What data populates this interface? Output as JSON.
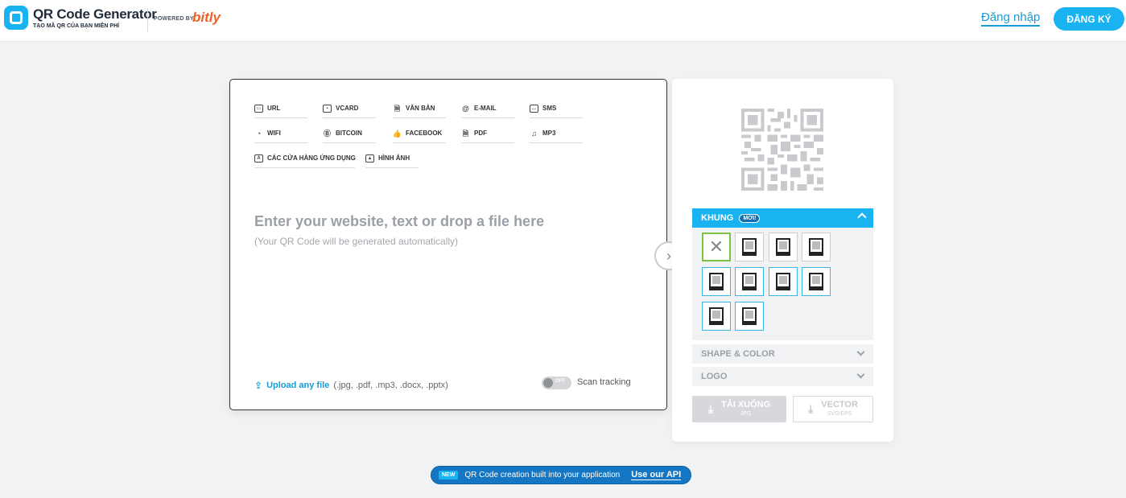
{
  "header": {
    "brand_title": "QR Code Generator",
    "brand_subtitle": "TẠO MÃ QR CỦA BẠN MIỄN PHÍ",
    "powered_by": "POWERED BY",
    "partner": "bitly",
    "login_label": "Đăng nhập",
    "signup_label": "ĐĂNG KÝ"
  },
  "types": [
    {
      "label": "URL",
      "icon": "url-icon"
    },
    {
      "label": "VCARD",
      "icon": "vcard-icon"
    },
    {
      "label": "VĂN BẢN",
      "icon": "text-icon"
    },
    {
      "label": "E-MAIL",
      "icon": "email-icon"
    },
    {
      "label": "SMS",
      "icon": "sms-icon"
    },
    {
      "label": "WIFI",
      "icon": "wifi-icon"
    },
    {
      "label": "BITCOIN",
      "icon": "bitcoin-icon"
    },
    {
      "label": "FACEBOOK",
      "icon": "facebook-icon"
    },
    {
      "label": "PDF",
      "icon": "pdf-icon"
    },
    {
      "label": "MP3",
      "icon": "mp3-icon"
    },
    {
      "label": "CÁC CỬA HÀNG ỨNG DỤNG",
      "icon": "app-store-icon"
    },
    {
      "label": "HÌNH ẢNH",
      "icon": "image-icon"
    }
  ],
  "input": {
    "heading": "Enter your website, text or drop a file here",
    "subheading": "(Your QR Code will be generated automatically)",
    "upload_label": "Upload any file",
    "upload_types": "(.jpg, .pdf, .mp3, .docx, .pptx)",
    "tracking_state": "OFF",
    "tracking_label": "Scan tracking"
  },
  "panel": {
    "frame_label": "KHUNG",
    "frame_badge": "MỚI!",
    "shape_color_label": "SHAPE & COLOR",
    "logo_label": "LOGO",
    "download_label": "TẢI XUỐNG",
    "download_format": "JPG",
    "vector_label": "VECTOR",
    "vector_format": "SVG/EPS"
  },
  "api_banner": {
    "badge": "NEW",
    "message": "QR Code creation built into your application",
    "link": "Use our API"
  },
  "colors": {
    "accent": "#1ab3f2",
    "link": "#1a9ad6",
    "bitly": "#ee6123",
    "selected_frame": "#7cc243"
  }
}
